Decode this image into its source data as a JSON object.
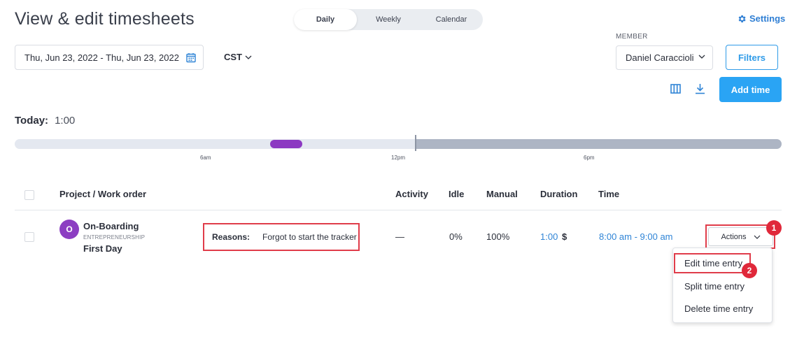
{
  "header": {
    "title": "View & edit timesheets",
    "tabs": [
      {
        "label": "Daily",
        "active": true
      },
      {
        "label": "Weekly",
        "active": false
      },
      {
        "label": "Calendar",
        "active": false
      }
    ],
    "settings_label": "Settings"
  },
  "filters": {
    "date_range": "Thu, Jun 23, 2022 - Thu, Jun 23, 2022",
    "timezone": "CST",
    "member_label": "MEMBER",
    "member_value": "Daniel Caraccioli",
    "filters_label": "Filters",
    "add_time_label": "Add time"
  },
  "today": {
    "label": "Today:",
    "value": "1:00"
  },
  "timeline": {
    "ticks": [
      "6am",
      "12pm",
      "6pm"
    ],
    "colors": {
      "past": "#e4e8f0",
      "future": "#adb5c4",
      "entry": "#8c39c2"
    }
  },
  "table": {
    "columns": [
      "Project / Work order",
      "Activity",
      "Idle",
      "Manual",
      "Duration",
      "Time"
    ],
    "rows": [
      {
        "avatar_letter": "O",
        "project": "On-Boarding",
        "client": "ENTREPRENEURSHIP",
        "task": "First Day",
        "reasons_label": "Reasons:",
        "reasons_value": "Forgot to start the tracker",
        "activity": "—",
        "idle": "0%",
        "manual": "100%",
        "duration": "1:00",
        "currency": "$",
        "time": "8:00 am - 9:00 am",
        "actions_label": "Actions"
      }
    ]
  },
  "actions_menu": {
    "items": [
      "Edit time entry",
      "Split time entry",
      "Delete time entry"
    ]
  },
  "annotations": {
    "badge1": "1",
    "badge2": "2",
    "color": "#e0283a"
  },
  "colors": {
    "accent": "#2aa4f4",
    "link": "#2f84d6",
    "avatar": "#8c3ec2"
  }
}
